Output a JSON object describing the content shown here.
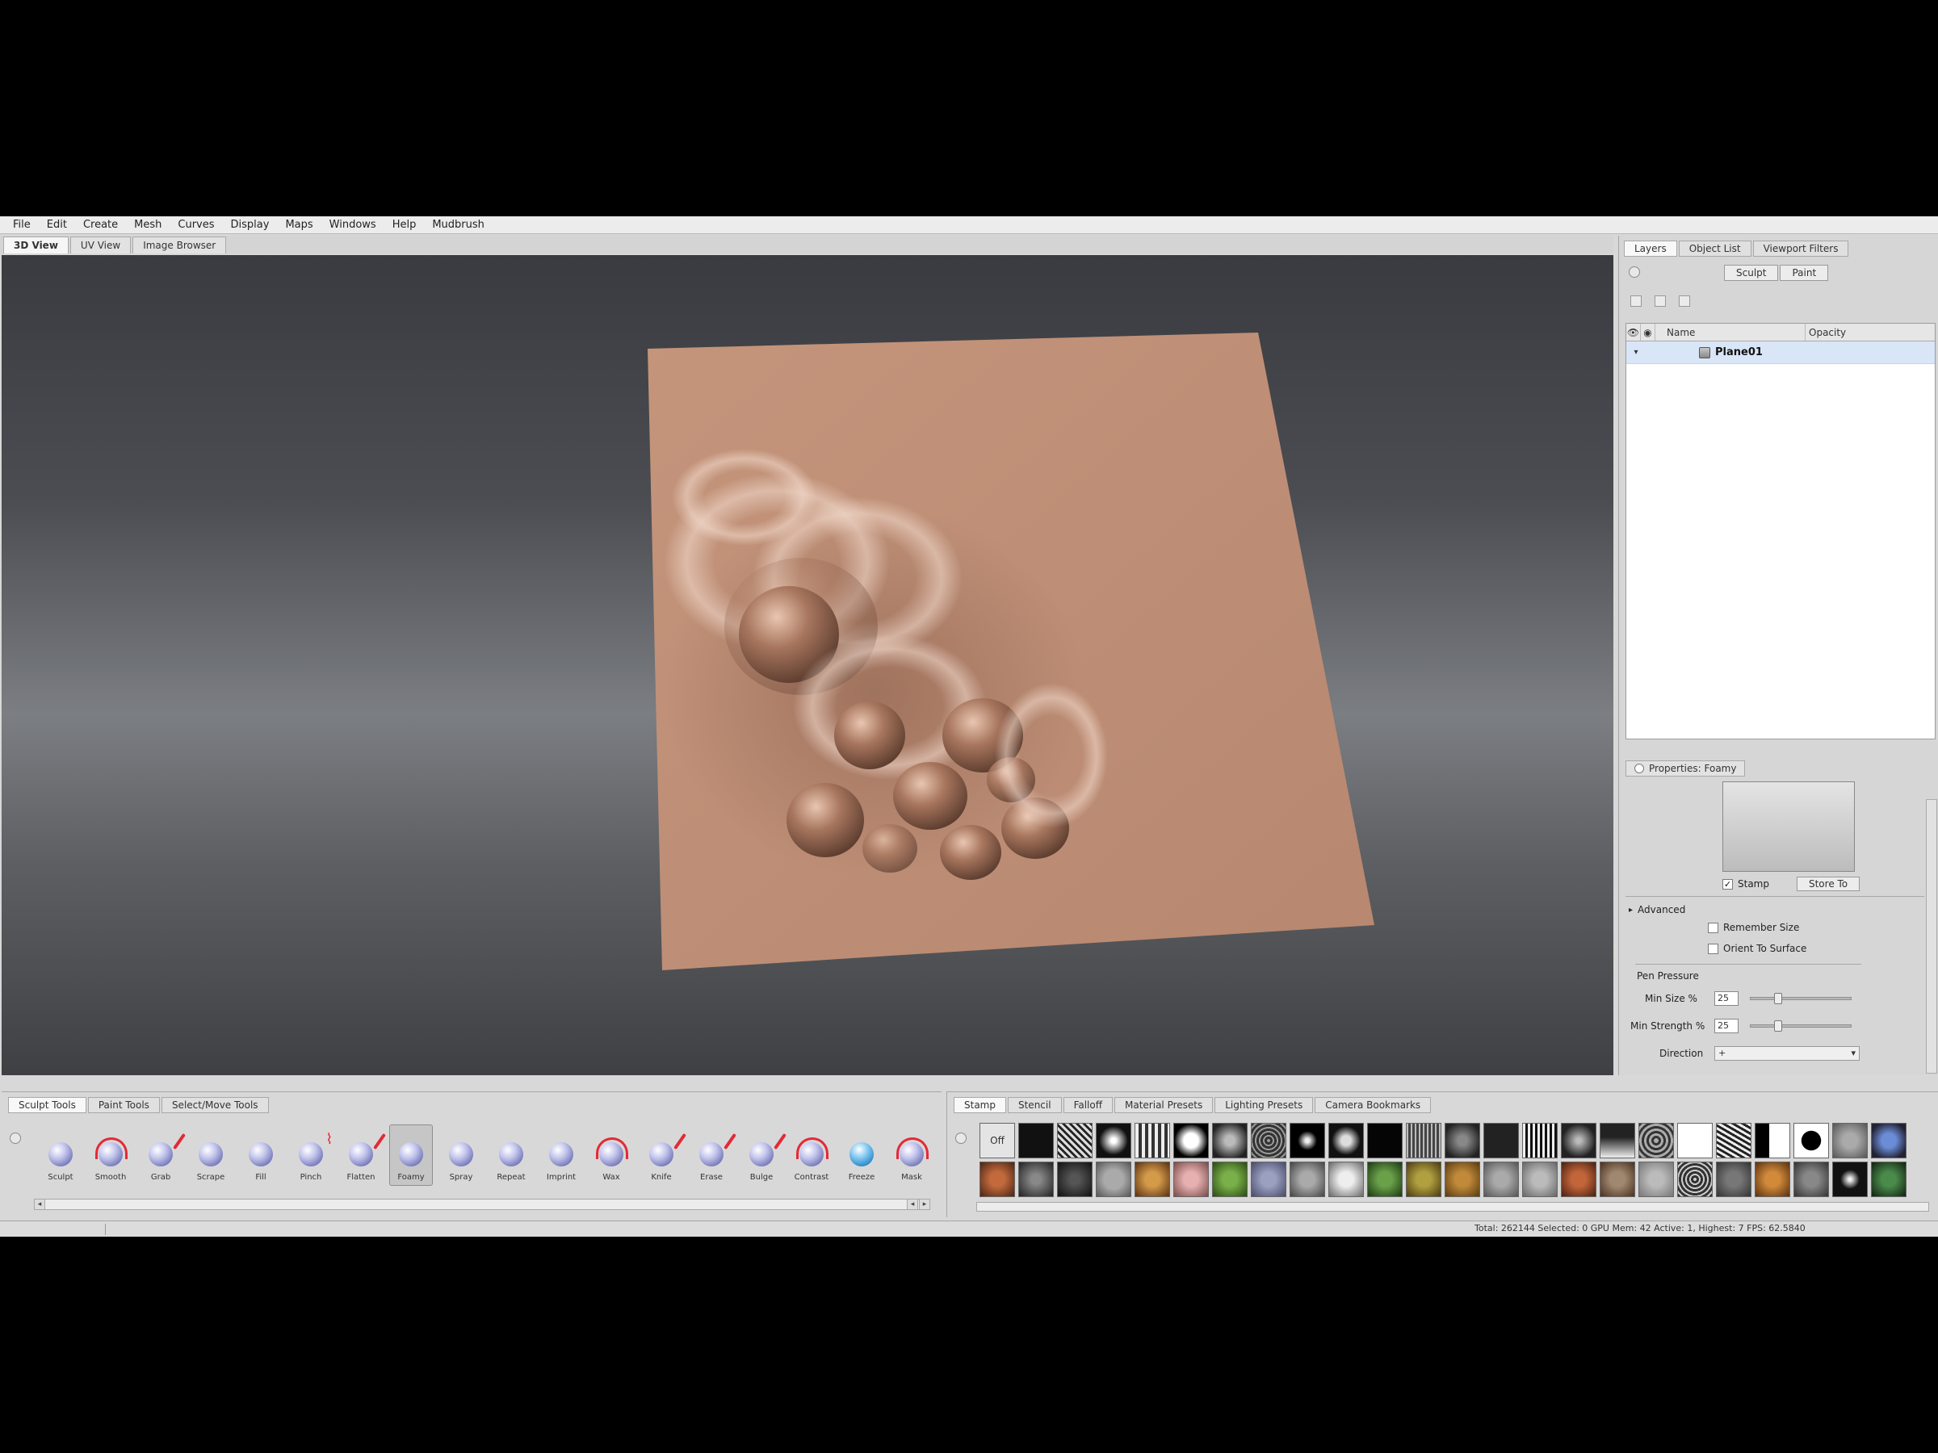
{
  "menu": [
    "File",
    "Edit",
    "Create",
    "Mesh",
    "Curves",
    "Display",
    "Maps",
    "Windows",
    "Help",
    "Mudbrush"
  ],
  "view_tabs": [
    "3D View",
    "UV View",
    "Image Browser"
  ],
  "right_tabs": [
    "Layers",
    "Object List",
    "Viewport Filters"
  ],
  "mode_buttons": [
    "Sculpt",
    "Paint"
  ],
  "layer_table": {
    "col_name": "Name",
    "col_opacity": "Opacity",
    "rows": [
      {
        "name": "Plane01"
      }
    ]
  },
  "properties": {
    "tab_label": "Properties: Foamy",
    "stamp_checkbox": "Stamp",
    "store_button": "Store To",
    "advanced_label": "Advanced",
    "remember_size": "Remember Size",
    "orient_to_surface": "Orient To Surface",
    "pen_pressure_label": "Pen Pressure",
    "min_size_label": "Min Size %",
    "min_size_value": "25",
    "min_size_fraction": 0.25,
    "min_strength_label": "Min Strength %",
    "min_strength_value": "25",
    "min_strength_fraction": 0.25,
    "direction_label": "Direction",
    "direction_value": "+"
  },
  "tool_tabs": [
    "Sculpt Tools",
    "Paint Tools",
    "Select/Move Tools"
  ],
  "tools": [
    {
      "label": "Sculpt",
      "icon": "sculpt-tool-icon"
    },
    {
      "label": "Smooth",
      "icon": "smooth-tool-icon"
    },
    {
      "label": "Grab",
      "icon": "grab-tool-icon"
    },
    {
      "label": "Scrape",
      "icon": "scrape-tool-icon"
    },
    {
      "label": "Fill",
      "icon": "fill-tool-icon"
    },
    {
      "label": "Pinch",
      "icon": "pinch-tool-icon"
    },
    {
      "label": "Flatten",
      "icon": "flatten-tool-icon"
    },
    {
      "label": "Foamy",
      "icon": "foamy-tool-icon",
      "active": true
    },
    {
      "label": "Spray",
      "icon": "spray-tool-icon"
    },
    {
      "label": "Repeat",
      "icon": "repeat-tool-icon"
    },
    {
      "label": "Imprint",
      "icon": "imprint-tool-icon"
    },
    {
      "label": "Wax",
      "icon": "wax-tool-icon"
    },
    {
      "label": "Knife",
      "icon": "knife-tool-icon"
    },
    {
      "label": "Erase",
      "icon": "erase-tool-icon"
    },
    {
      "label": "Bulge",
      "icon": "bulge-tool-icon"
    },
    {
      "label": "Contrast",
      "icon": "contrast-tool-icon"
    },
    {
      "label": "Freeze",
      "icon": "freeze-tool-icon"
    },
    {
      "label": "Mask",
      "icon": "mask-tool-icon"
    }
  ],
  "stamp_tabs": [
    "Stamp",
    "Stencil",
    "Falloff",
    "Material Presets",
    "Lighting Presets",
    "Camera Bookmarks"
  ],
  "stamp_off_label": "Off",
  "status_text": "Total: 262144  Selected: 0  GPU Mem: 42  Active: 1, Highest: 7  FPS: 62.5840",
  "colors": {
    "mesh": "#c08c72",
    "accent_red": "#e22a36",
    "selection_row": "#d9e6f7"
  }
}
